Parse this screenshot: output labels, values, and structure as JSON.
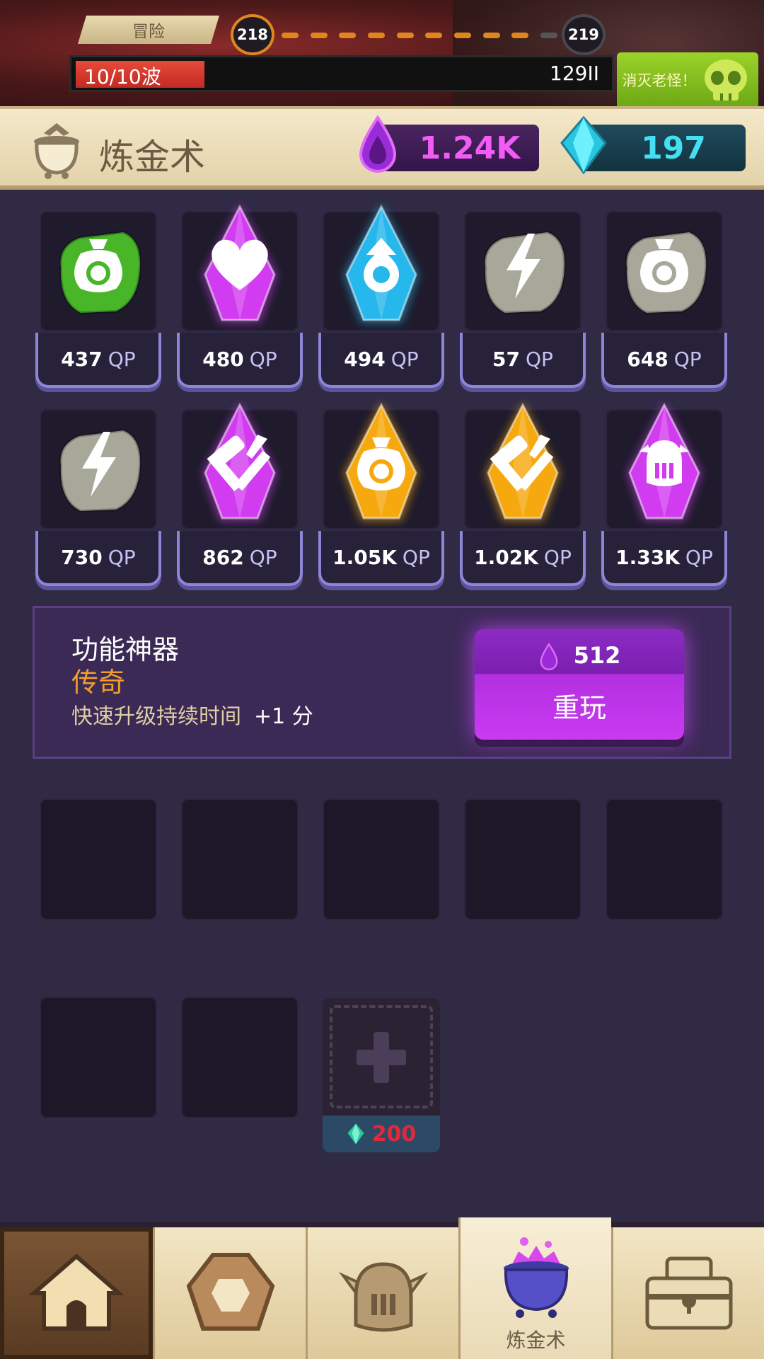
{
  "battle": {
    "mode_tab": "冒险",
    "current_stage": "218",
    "next_stage": "219",
    "wave_label": "10/10波",
    "wave_progress_fraction": 0.24,
    "enemy_hp": "129II",
    "boss_button": "消灭老怪！"
  },
  "header": {
    "title": "炼金术",
    "elixir": "1.24K",
    "gems": "197"
  },
  "artifacts": [
    {
      "qp": "437",
      "unit": "QP",
      "color": "#49b62a",
      "icon": "moneybag-icon",
      "shape": "rock"
    },
    {
      "qp": "480",
      "unit": "QP",
      "color": "#d23cf0",
      "icon": "heart-icon",
      "shape": "crystal"
    },
    {
      "qp": "494",
      "unit": "QP",
      "color": "#26b8ec",
      "icon": "elixir-icon",
      "shape": "crystal"
    },
    {
      "qp": "57",
      "unit": "QP",
      "color": "#a8a89a",
      "icon": "lightning-icon",
      "shape": "rock"
    },
    {
      "qp": "648",
      "unit": "QP",
      "color": "#a8a89a",
      "icon": "moneybag-icon",
      "shape": "rock"
    },
    {
      "qp": "730",
      "unit": "QP",
      "color": "#a8a89a",
      "icon": "lightning-icon",
      "shape": "rock"
    },
    {
      "qp": "862",
      "unit": "QP",
      "color": "#d23cf0",
      "icon": "hammer-sword-icon",
      "shape": "crystal"
    },
    {
      "qp": "1.05K",
      "unit": "QP",
      "color": "#f6a90f",
      "icon": "moneybag-icon",
      "shape": "crystal"
    },
    {
      "qp": "1.02K",
      "unit": "QP",
      "color": "#f6a90f",
      "icon": "hammer-sword-icon",
      "shape": "crystal"
    },
    {
      "qp": "1.33K",
      "unit": "QP",
      "color": "#d23cf0",
      "icon": "helmet-icon",
      "shape": "crystal"
    }
  ],
  "selected": {
    "name": "功能神器",
    "rarity": "传奇",
    "effect": "快速升级持续时间",
    "bonus": "+1 分",
    "reroll_cost": "512",
    "reroll_label": "重玩"
  },
  "add_slot": {
    "price": "200"
  },
  "nav": {
    "active_label": "炼金术",
    "tabs": [
      "home-icon",
      "shield-icon",
      "hero-helmet-icon",
      "cauldron-icon",
      "treasure-chest-icon"
    ]
  }
}
